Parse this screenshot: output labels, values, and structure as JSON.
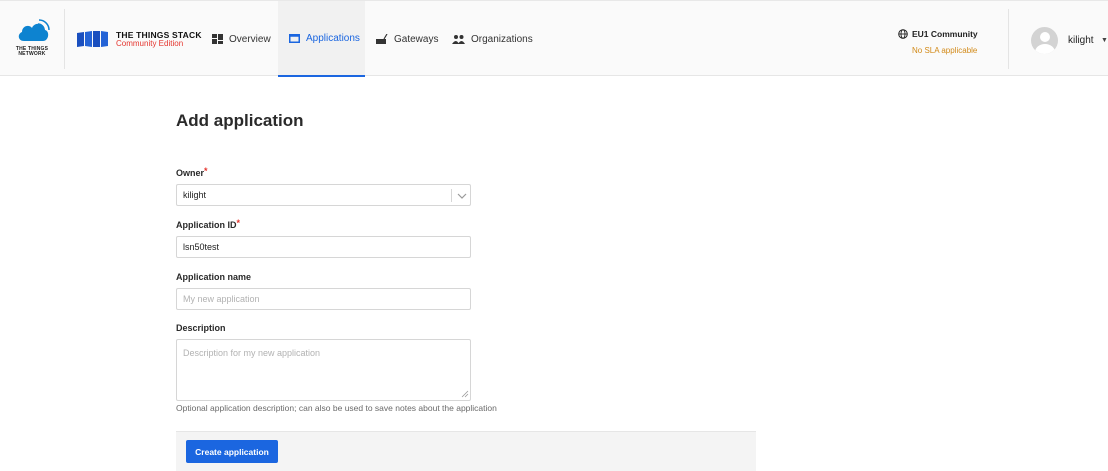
{
  "header": {
    "ttn_logo_text": "THE THINGS NETWORK",
    "brand_title": "THE THINGS STACK",
    "brand_subtitle": "Community Edition",
    "nav": [
      {
        "label": "Overview",
        "icon": "dashboard-icon"
      },
      {
        "label": "Applications",
        "icon": "application-window-icon",
        "active": true
      },
      {
        "label": "Gateways",
        "icon": "gateway-icon"
      },
      {
        "label": "Organizations",
        "icon": "people-icon"
      }
    ],
    "cluster": {
      "label": "EU1 Community",
      "icon": "globe-icon",
      "sla_note": "No SLA applicable"
    },
    "user": {
      "name": "kilight",
      "icon": "avatar-icon"
    }
  },
  "page": {
    "title": "Add application"
  },
  "form": {
    "owner": {
      "label": "Owner",
      "required_mark": "*",
      "value": "kilight"
    },
    "app_id": {
      "label": "Application ID",
      "required_mark": "*",
      "value": "lsn50test"
    },
    "app_name": {
      "label": "Application name",
      "value": "",
      "placeholder": "My new application"
    },
    "description": {
      "label": "Description",
      "value": "",
      "placeholder": "Description for my new application",
      "help": "Optional application description; can also be used to save notes about the application"
    },
    "submit_label": "Create application"
  },
  "colors": {
    "accent": "#1b66e0",
    "brand_red": "#e5362f",
    "warning": "#d28a18",
    "ttn_blue": "#0d83d0"
  }
}
